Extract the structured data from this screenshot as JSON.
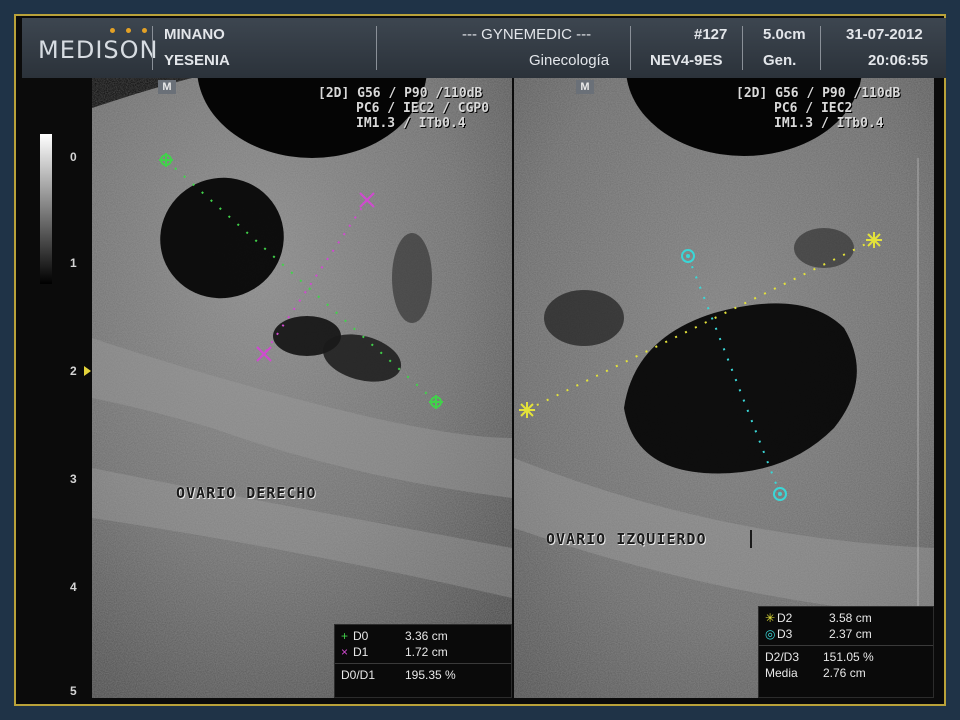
{
  "header": {
    "brand": "MEDISON",
    "patient_last": "MINANO",
    "patient_first": "YESENIA",
    "institution": "--- GYNEMEDIC ---",
    "exam_type": "Ginecología",
    "study_number": "#127",
    "probe": "NEV4-9ES",
    "depth": "5.0cm",
    "preset": "Gen.",
    "date": "31-07-2012",
    "time": "20:06:55"
  },
  "left_panel": {
    "marker": "M",
    "params": [
      "[2D] G56 / P90 /110dB",
      "PC6 / IEC2 / CGP0",
      "IM1.3 / ITb0.4"
    ],
    "label": "OVARIO  DERECHO",
    "measurements": [
      {
        "symbol": "+",
        "name": "D0",
        "value": "3.36 cm",
        "color": "#41d24a"
      },
      {
        "symbol": "×",
        "name": "D1",
        "value": "1.72 cm",
        "color": "#d04ad0"
      }
    ],
    "ratio": {
      "name": "D0/D1",
      "value": "195.35 %"
    }
  },
  "right_panel": {
    "marker": "M",
    "params": [
      "[2D] G56 / P90 /110dB",
      "PC6 / IEC2",
      "IM1.3 / ITb0.4"
    ],
    "label": "OVARIO  IZQUIERDO",
    "measurements": [
      {
        "symbol": "✳",
        "name": "D2",
        "value": "3.58 cm",
        "color": "#e3e23a"
      },
      {
        "symbol": "◎",
        "name": "D3",
        "value": "2.37 cm",
        "color": "#3ad7d7"
      }
    ],
    "ratio": {
      "name": "D2/D3",
      "value": "151.05 %"
    },
    "mean": {
      "name": "Media",
      "value": "2.76 cm"
    }
  },
  "depth_scale": {
    "ticks": [
      "0",
      "1",
      "2",
      "3",
      "4",
      "5"
    ]
  },
  "colors": {
    "accent_frame": "#b9a23a",
    "header_bg": "#3d4650",
    "logo_dots": "#e3a126"
  }
}
